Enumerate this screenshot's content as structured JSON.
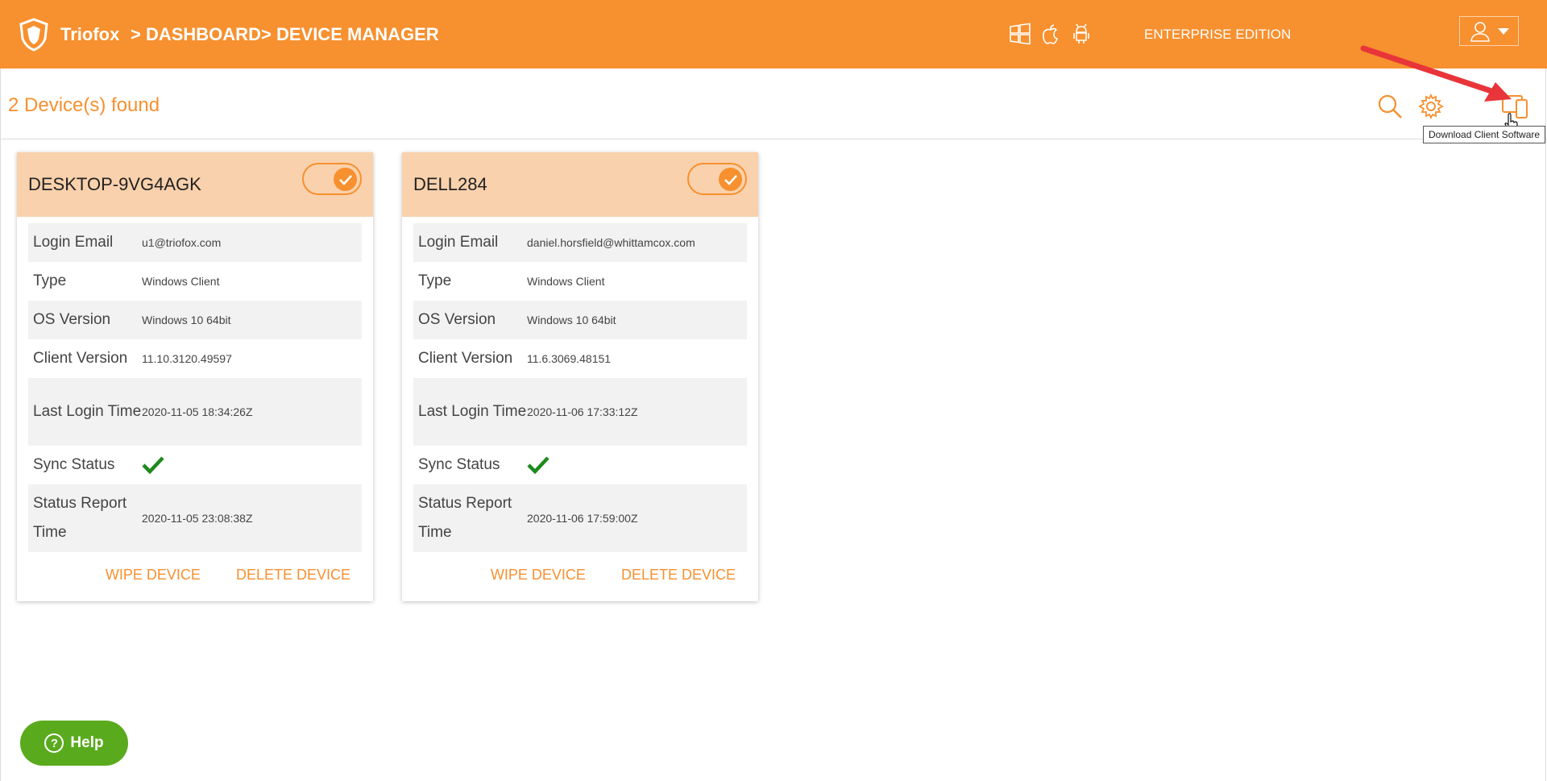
{
  "header": {
    "brand": "Triofox",
    "crumb1": "> DASHBOARD",
    "crumb2": "> DEVICE MANAGER",
    "edition": "ENTERPRISE EDITION",
    "os_icons": [
      "windows-icon",
      "apple-icon",
      "android-icon"
    ]
  },
  "toolbar": {
    "found_text": "2 Device(s) found",
    "tooltip": "Download Client Software"
  },
  "labels": {
    "login_email": "Login Email",
    "type": "Type",
    "os_version": "OS Version",
    "client_version": "Client Version",
    "last_login": "Last Login Time",
    "sync_status": "Sync Status",
    "status_report": "Status Report Time",
    "wipe": "WIPE DEVICE",
    "delete": "DELETE DEVICE"
  },
  "devices": [
    {
      "name": "DESKTOP-9VG4AGK",
      "login_email": "u1@triofox.com",
      "type": "Windows Client",
      "os_version": "Windows 10 64bit",
      "client_version": "11.10.3120.49597",
      "last_login": "2020-11-05 18:34:26Z",
      "status_report": "2020-11-05 23:08:38Z",
      "enabled": true
    },
    {
      "name": "DELL284",
      "login_email": "daniel.horsfield@whittamcox.com",
      "type": "Windows Client",
      "os_version": "Windows 10 64bit",
      "client_version": "11.6.3069.48151",
      "last_login": "2020-11-06 17:33:12Z",
      "status_report": "2020-11-06 17:59:00Z",
      "enabled": true
    }
  ],
  "help": {
    "label": "Help"
  },
  "colors": {
    "accent": "#f7902f",
    "card_header": "#f9d1ac",
    "help": "#5aaa1e",
    "check": "#1e8a1e"
  }
}
